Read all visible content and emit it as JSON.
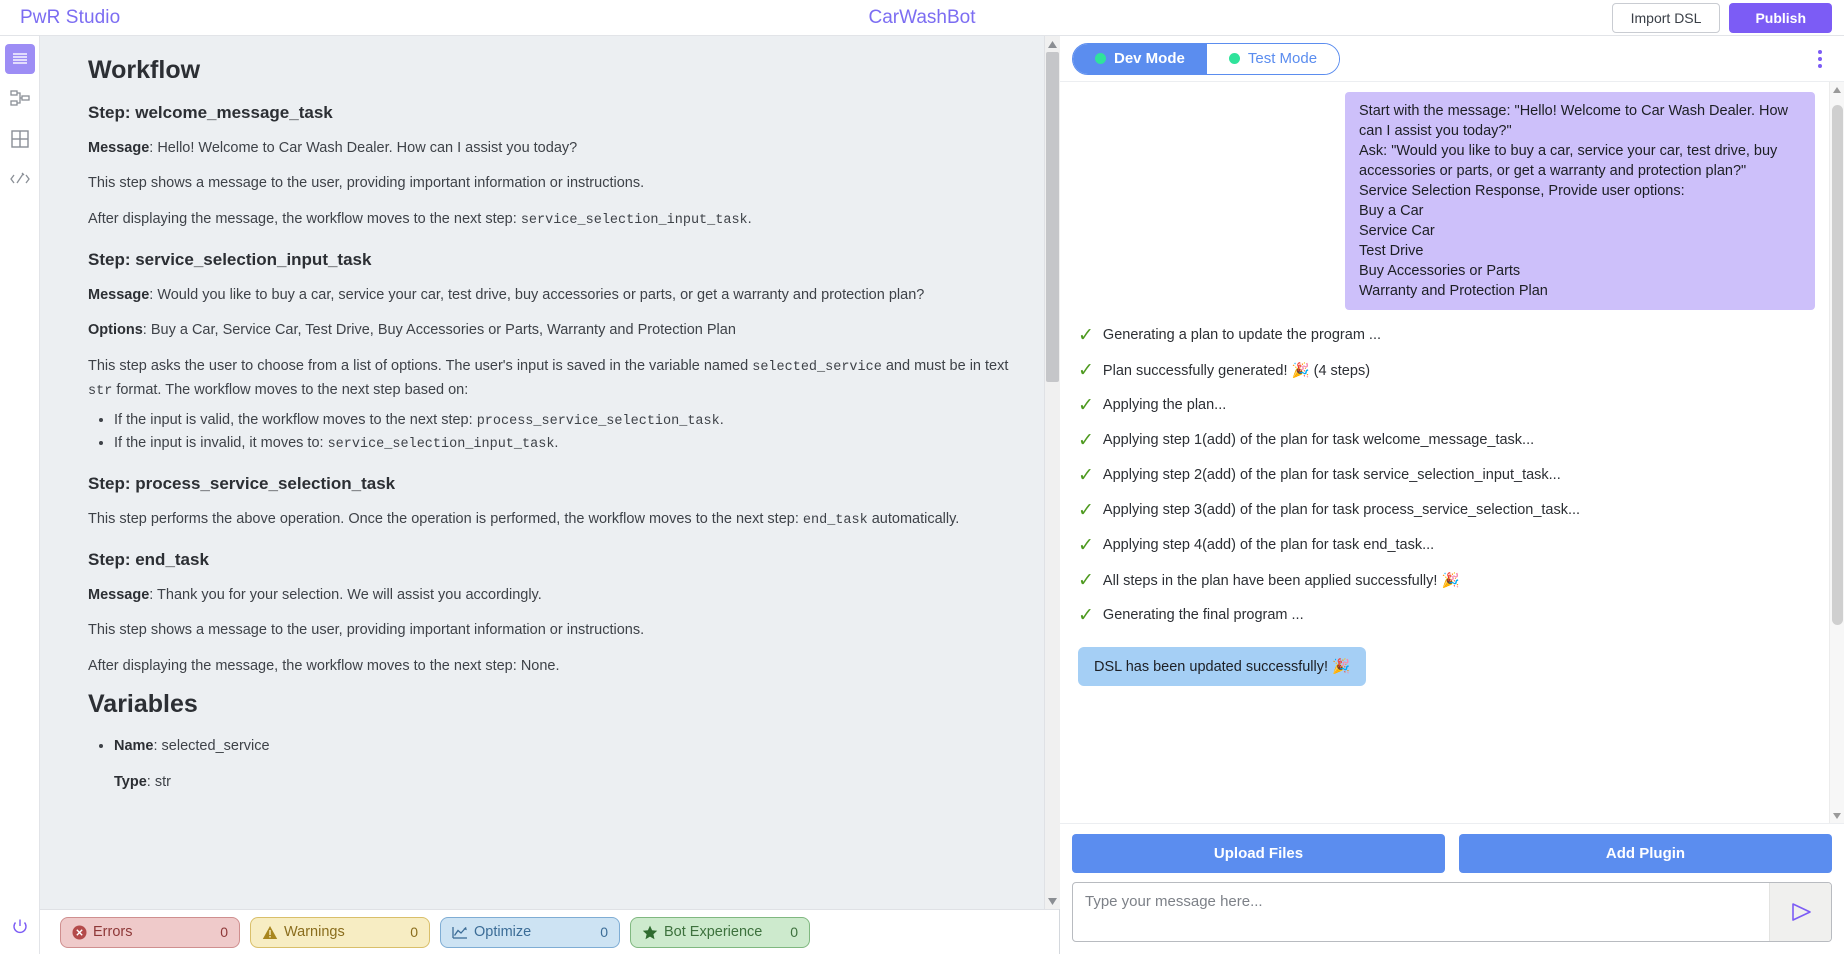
{
  "topbar": {
    "brand": "PwR Studio",
    "app_title": "CarWashBot",
    "import_label": "Import DSL",
    "publish_label": "Publish"
  },
  "rail": {
    "items": [
      {
        "icon": "document-lines-icon",
        "name": "sidebar-item-document",
        "active": true
      },
      {
        "icon": "flow-hierarchy-icon",
        "name": "sidebar-item-flow",
        "active": false
      },
      {
        "icon": "grid-icon",
        "name": "sidebar-item-grid",
        "active": false
      },
      {
        "icon": "code-edit-icon",
        "name": "sidebar-item-code",
        "active": false
      }
    ],
    "bottom_icon": "power-icon"
  },
  "doc": {
    "title": "Workflow",
    "steps": [
      {
        "heading": "Step: welcome_message_task",
        "message_label": "Message",
        "message": ": Hello! Welcome to Car Wash Dealer. How can I assist you today?",
        "desc": "This step shows a message to the user, providing important information or instructions.",
        "next_pre": "After displaying the message, the workflow moves to the next step: ",
        "next_code": "service_selection_input_task",
        "next_post": "."
      },
      {
        "heading": "Step: service_selection_input_task",
        "message_label": "Message",
        "message": ": Would you like to buy a car, service your car, test drive, buy accessories or parts, or get a warranty and protection plan?",
        "options_label": "Options",
        "options": ": Buy a Car, Service Car, Test Drive, Buy Accessories or Parts, Warranty and Protection Plan",
        "body_pre": "This step asks the user to choose from a list of options. The user's input is saved in the variable named ",
        "body_var": "selected_service",
        "body_mid": " and must be in text ",
        "body_type": "str",
        "body_post": " format. The workflow moves to the next step based on:",
        "bullets": [
          {
            "pre": "If the input is valid, the workflow moves to the next step: ",
            "code": "process_service_selection_task",
            "post": "."
          },
          {
            "pre": "If the input is invalid, it moves to: ",
            "code": "service_selection_input_task",
            "post": "."
          }
        ]
      },
      {
        "heading": "Step: process_service_selection_task",
        "body_pre": "This step performs the above operation. Once the operation is performed, the workflow moves to the next step: ",
        "body_code": "end_task",
        "body_post": " automatically."
      },
      {
        "heading": "Step: end_task",
        "message_label": "Message",
        "message": ": Thank you for your selection. We will assist you accordingly.",
        "desc": "This step shows a message to the user, providing important information or instructions.",
        "next_pre": "After displaying the message, the workflow moves to the next step: ",
        "next_code": "None",
        "next_post": "."
      }
    ],
    "variables_title": "Variables",
    "variables": [
      {
        "name_label": "Name",
        "name_value": ": selected_service",
        "type_label": "Type",
        "type_value": ": str"
      }
    ]
  },
  "statusbar": {
    "chips": [
      {
        "icon": "error-circle-icon",
        "label": "Errors",
        "count": "0"
      },
      {
        "icon": "warning-triangle-icon",
        "label": "Warnings",
        "count": "0"
      },
      {
        "icon": "chart-line-icon",
        "label": "Optimize",
        "count": "0"
      },
      {
        "icon": "star-icon",
        "label": "Bot Experience",
        "count": "0"
      }
    ]
  },
  "chat": {
    "modes": [
      {
        "label": "Dev Mode",
        "active": true
      },
      {
        "label": "Test Mode",
        "active": false
      }
    ],
    "menu_icon": "kebab-menu-icon",
    "user_message": "Start with the message: \"Hello! Welcome to Car Wash Dealer. How can I assist you today?\"\nAsk: \"Would you like to buy a car, service your car, test drive, buy accessories or parts, or get a warranty and protection plan?\"\nService Selection Response, Provide user options:\nBuy a Car\nService Car\nTest Drive\nBuy Accessories or Parts\nWarranty and Protection Plan",
    "status_lines": [
      "Generating a plan to update the program ...",
      "Plan successfully generated! 🎉 (4 steps)",
      "Applying the plan...",
      "Applying step 1(add) of the plan for task welcome_message_task...",
      "Applying step 2(add) of the plan for task service_selection_input_task...",
      "Applying step 3(add) of the plan for task process_service_selection_task...",
      "Applying step 4(add) of the plan for task end_task...",
      "All steps in the plan have been applied successfully! 🎉",
      "Generating the final program ..."
    ],
    "bot_message": "DSL has been updated successfully! 🎉",
    "upload_label": "Upload Files",
    "plugin_label": "Add Plugin",
    "input_placeholder": "Type your message here...",
    "input_value": "",
    "send_icon": "send-arrow-icon"
  },
  "colors": {
    "brand_purple": "#7c6df2",
    "publish_purple": "#7c5cf5",
    "chat_blue": "#5b8def",
    "user_bubble": "#cdc0fa",
    "bot_bubble": "#a5cff5",
    "check_green": "#4e9a20"
  }
}
